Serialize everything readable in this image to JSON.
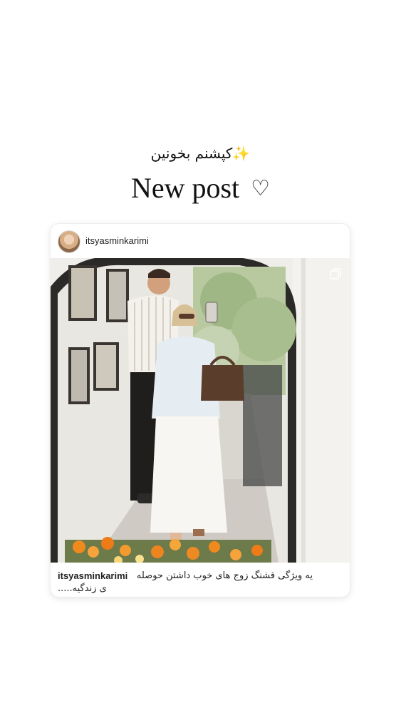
{
  "story": {
    "top_caption": "کپشنم بخونین✨",
    "headline": "New post",
    "heart_icon": "♡"
  },
  "post": {
    "username": "itsyasminkarimi",
    "caption_username": "itsyasminkarimi",
    "caption_line1": "یه ویژگی قشنگ زوج های خوب داشتن حوصله",
    "caption_line2": "ی زندگیه.....",
    "multi_image_icon": "carousel-icon"
  }
}
